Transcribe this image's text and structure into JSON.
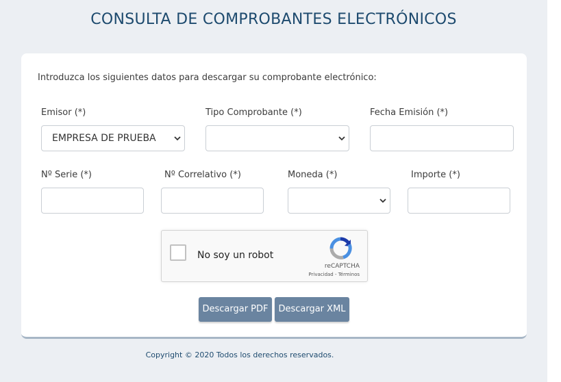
{
  "header": {
    "title": "CONSULTA DE COMPROBANTES ELECTRÓNICOS"
  },
  "form": {
    "intro": "Introduzca los siguientes datos para descargar su comprobante electrónico:",
    "emisor": {
      "label": "Emisor (*)",
      "value": "EMPRESA DE PRUEBA"
    },
    "tipo_comprobante": {
      "label": "Tipo Comprobante (*)",
      "value": ""
    },
    "fecha_emision": {
      "label": "Fecha Emisión (*)",
      "value": ""
    },
    "serie": {
      "label": "Nº Serie (*)",
      "value": ""
    },
    "correlativo": {
      "label": "Nº Correlativo (*)",
      "value": ""
    },
    "moneda": {
      "label": "Moneda (*)",
      "value": ""
    },
    "importe": {
      "label": "Importe (*)",
      "value": ""
    }
  },
  "captcha": {
    "label": "No soy un robot",
    "brand": "reCAPTCHA",
    "links": "Privacidad - Términos",
    "icon": "recaptcha-logo-icon"
  },
  "actions": {
    "pdf_label": "Descargar PDF",
    "xml_label": "Descargar XML"
  },
  "footer": {
    "copyright": "Copyright © 2020 Todos los derechos reservados."
  },
  "colors": {
    "title": "#1d4a6e",
    "button": "#6a84a0",
    "background": "#eceff3"
  }
}
